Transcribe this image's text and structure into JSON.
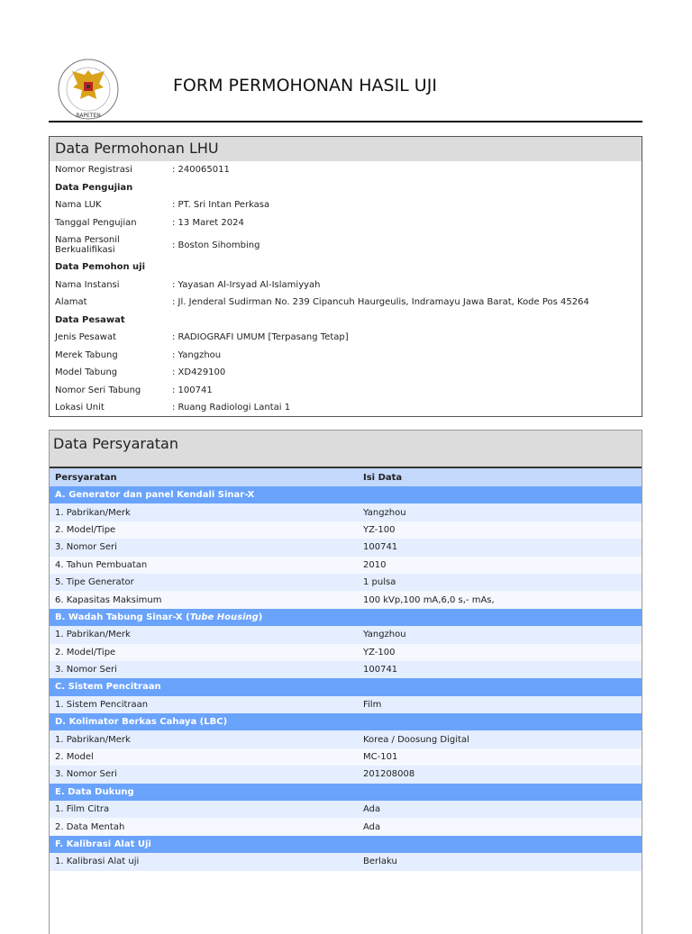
{
  "header": {
    "title": "FORM PERMOHONAN HASIL UJI",
    "logo_text": "BADAN PENGAWAS TENAGA NUKLIR - BAPETEN"
  },
  "lhu": {
    "title": "Data Permohonan LHU",
    "rows": [
      {
        "label": "Nomor Registrasi",
        "value": ": 240065011"
      },
      {
        "section": "Data Pengujian"
      },
      {
        "label": "Nama LUK",
        "value": ": PT. Sri Intan Perkasa"
      },
      {
        "label": "Tanggal Pengujian",
        "value": ": 13 Maret 2024"
      },
      {
        "label": "Nama Personil Berkualifikasi",
        "value": ": Boston Sihombing",
        "tall": true
      },
      {
        "section": "Data Pemohon uji"
      },
      {
        "label": "Nama Instansi",
        "value": ": Yayasan Al-Irsyad Al-Islamiyyah"
      },
      {
        "label": "Alamat",
        "value": ": Jl. Jenderal Sudirman No. 239 Cipancuh Haurgeulis, Indramayu Jawa Barat, Kode Pos 45264"
      },
      {
        "section": "Data Pesawat"
      },
      {
        "label": "Jenis Pesawat",
        "value": ": RADIOGRAFI UMUM [Terpasang Tetap]"
      },
      {
        "label": "Merek Tabung",
        "value": ": Yangzhou"
      },
      {
        "label": "Model Tabung",
        "value": ": XD429100"
      },
      {
        "label": "Nomor Seri Tabung",
        "value": ": 100741"
      },
      {
        "label": "Lokasi Unit",
        "value": ": Ruang Radiologi Lantai 1"
      }
    ]
  },
  "persyaratan": {
    "title": "Data Persyaratan",
    "col1": "Persyaratan",
    "col2": "Isi Data",
    "rows": [
      {
        "section": "A. Generator dan panel Kendali Sinar-X"
      },
      {
        "label": "1. Pabrikan/Merk",
        "value": "Yangzhou"
      },
      {
        "label": "2. Model/Tipe",
        "value": "YZ-100"
      },
      {
        "label": "3. Nomor Seri",
        "value": "100741"
      },
      {
        "label": "4. Tahun Pembuatan",
        "value": "2010"
      },
      {
        "label": "5. Tipe Generator",
        "value": "1 pulsa"
      },
      {
        "label": "6. Kapasitas Maksimum",
        "value": "100 kVp,100 mA,6,0 s,- mAs,"
      },
      {
        "section": "B. Wadah Tabung Sinar-X (",
        "section_em": "Tube Housing",
        "section_end": ")"
      },
      {
        "label": "1. Pabrikan/Merk",
        "value": "Yangzhou"
      },
      {
        "label": "2. Model/Tipe",
        "value": "YZ-100"
      },
      {
        "label": "3. Nomor Seri",
        "value": "100741"
      },
      {
        "section": "C. Sistem Pencitraan"
      },
      {
        "label": "1. Sistem Pencitraan",
        "value": "Film"
      },
      {
        "section": "D. Kolimator Berkas Cahaya (LBC)"
      },
      {
        "label": "1. Pabrikan/Merk",
        "value": "Korea / Doosung Digital"
      },
      {
        "label": "2. Model",
        "value": "MC-101"
      },
      {
        "label": "3. Nomor Seri",
        "value": "201208008"
      },
      {
        "section": "E. Data Dukung"
      },
      {
        "label": "1. Film Citra",
        "value": "Ada"
      },
      {
        "label": "2. Data Mentah",
        "value": "Ada"
      },
      {
        "section": "F. Kalibrasi Alat Uji"
      },
      {
        "label": "1. Kalibrasi Alat uji",
        "value": "Berlaku"
      }
    ]
  }
}
